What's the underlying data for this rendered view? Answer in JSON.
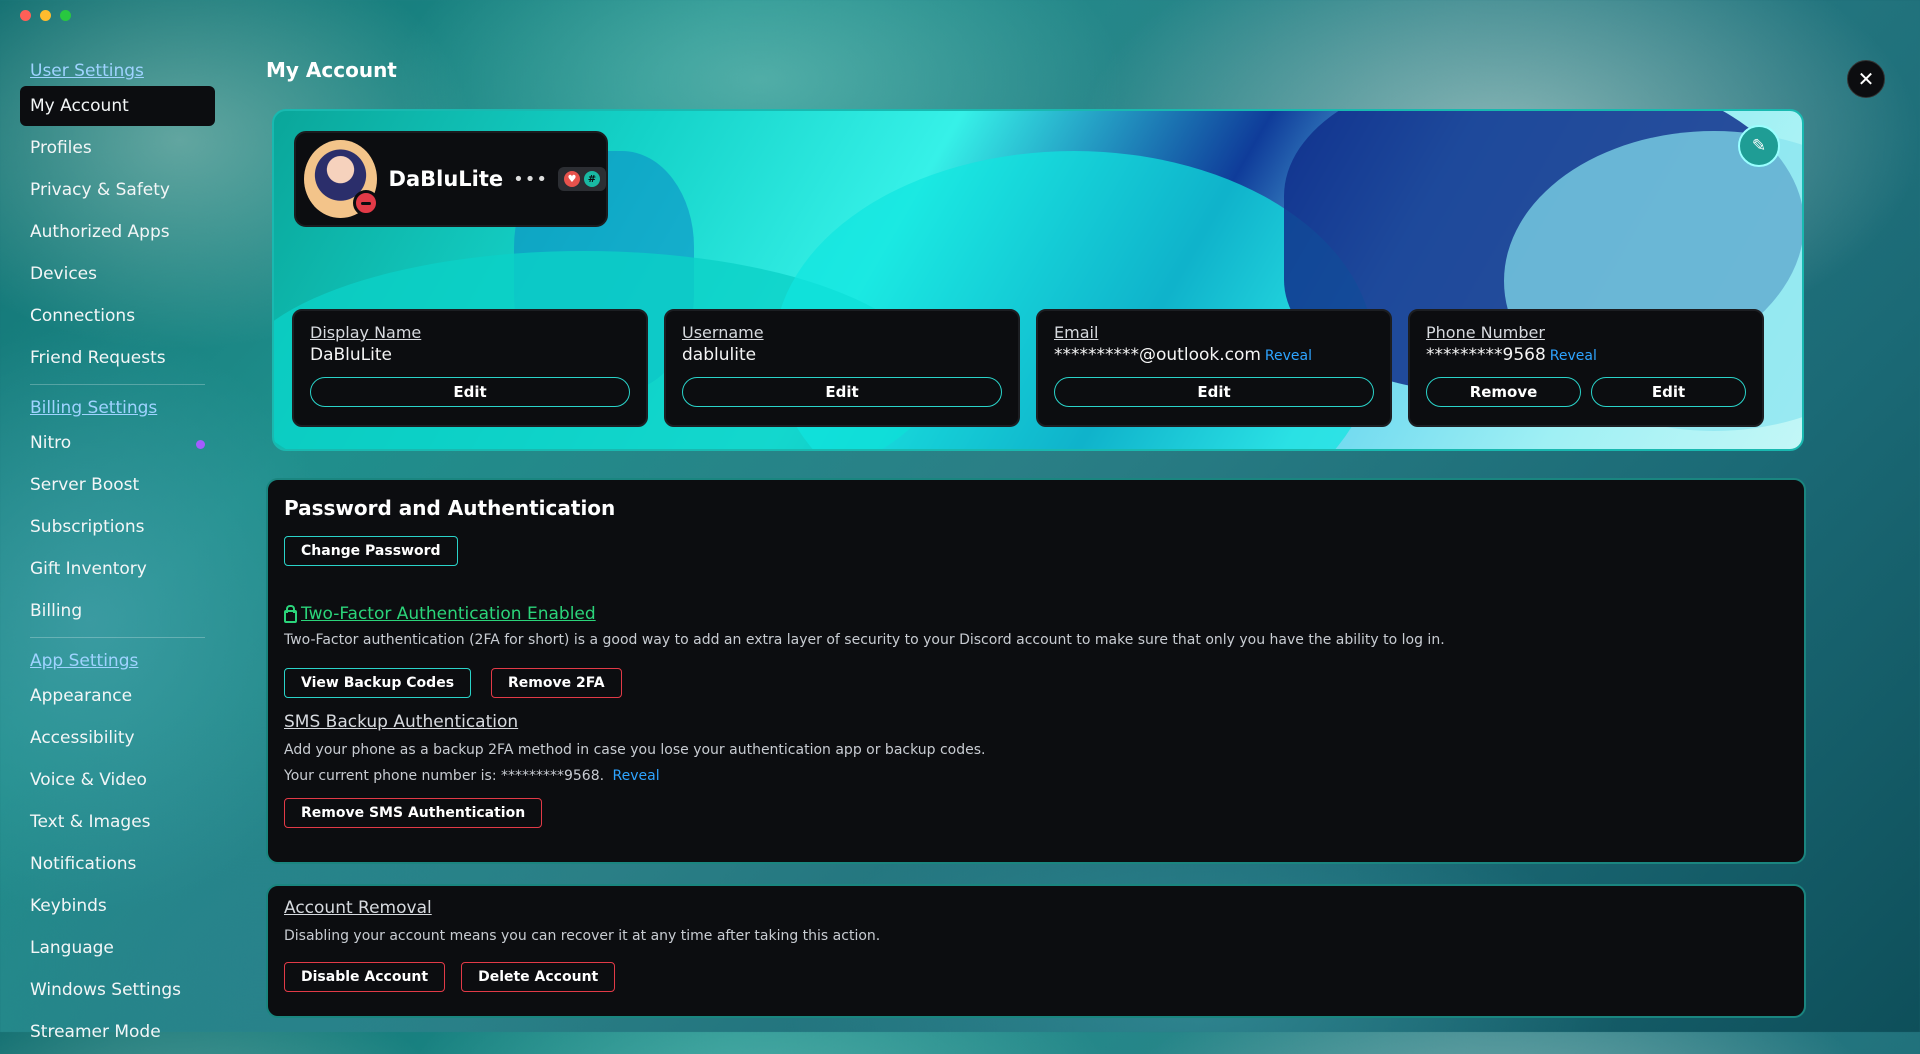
{
  "sidebar": {
    "user_settings_heading": "User Settings",
    "user_items": [
      {
        "label": "My Account"
      },
      {
        "label": "Profiles"
      },
      {
        "label": "Privacy & Safety"
      },
      {
        "label": "Authorized Apps"
      },
      {
        "label": "Devices"
      },
      {
        "label": "Connections"
      },
      {
        "label": "Friend Requests"
      }
    ],
    "billing_heading": "Billing Settings",
    "billing_items": [
      {
        "label": "Nitro"
      },
      {
        "label": "Server Boost"
      },
      {
        "label": "Subscriptions"
      },
      {
        "label": "Gift Inventory"
      },
      {
        "label": "Billing"
      }
    ],
    "app_heading": "App Settings",
    "app_items": [
      {
        "label": "Appearance"
      },
      {
        "label": "Accessibility"
      },
      {
        "label": "Voice & Video"
      },
      {
        "label": "Text & Images"
      },
      {
        "label": "Notifications"
      },
      {
        "label": "Keybinds"
      },
      {
        "label": "Language"
      },
      {
        "label": "Windows Settings"
      },
      {
        "label": "Streamer Mode"
      }
    ]
  },
  "page_title": "My Account",
  "profile": {
    "username": "DaBluLite",
    "badges": [
      "heart-badge",
      "hashtag-badge"
    ],
    "status_color": "#e23a47"
  },
  "fields": {
    "display_name": {
      "label": "Display Name",
      "value": "DaBluLite",
      "edit": "Edit"
    },
    "username": {
      "label": "Username",
      "value": "dablulite",
      "edit": "Edit"
    },
    "email": {
      "label": "Email",
      "value": "**********@outlook.com",
      "reveal": "Reveal",
      "edit": "Edit"
    },
    "phone": {
      "label": "Phone Number",
      "value": "*********9568",
      "reveal": "Reveal",
      "remove": "Remove",
      "edit": "Edit"
    }
  },
  "auth": {
    "title": "Password and Authentication",
    "change_password": "Change Password",
    "twofa_title": "Two-Factor Authentication Enabled",
    "twofa_desc": "Two-Factor authentication (2FA for short) is a good way to add an extra layer of security to your Discord account to make sure that only you have the ability to log in.",
    "view_backup": "View Backup Codes",
    "remove_2fa": "Remove 2FA",
    "sms_title": "SMS Backup Authentication",
    "sms_desc": "Add your phone as a backup 2FA method in case you lose your authentication app or backup codes.",
    "sms_phone_text": "Your current phone number is: *********9568.",
    "sms_reveal": "Reveal",
    "remove_sms": "Remove SMS Authentication"
  },
  "removal": {
    "title": "Account Removal",
    "desc": "Disabling your account means you can recover it at any time after taking this action.",
    "disable": "Disable Account",
    "delete": "Delete Account"
  },
  "colors": {
    "accent": "#2ad3c9",
    "danger": "#e23a47",
    "link": "#2ea4ff",
    "success": "#2bd47a",
    "nitro_dot": "#a35cff"
  }
}
